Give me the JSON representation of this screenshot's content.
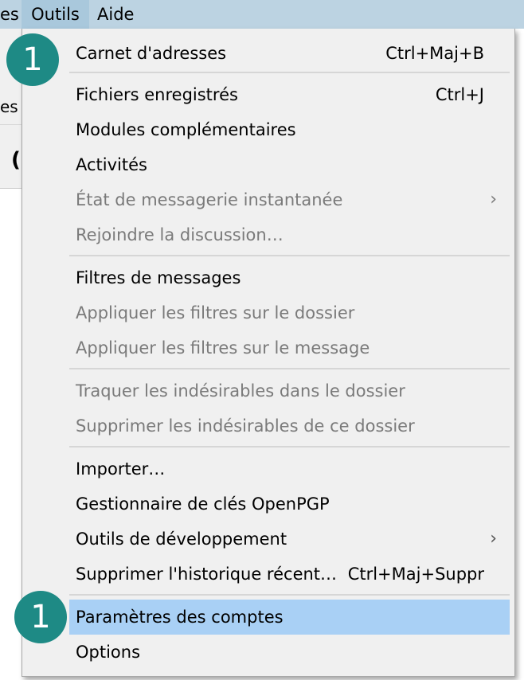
{
  "menubar": {
    "items": [
      {
        "label": "es",
        "active": false
      },
      {
        "label": "Outils",
        "active": true
      },
      {
        "label": "Aide",
        "active": false
      }
    ]
  },
  "background": {
    "tab_fragment": "es",
    "toolbar_fragment": "("
  },
  "menu": {
    "items": [
      {
        "label": "Carnet d'adresses",
        "shortcut": "Ctrl+Maj+B",
        "disabled": false,
        "submenu": false
      },
      {
        "label": "Fichiers enregistrés",
        "shortcut": "Ctrl+J",
        "disabled": false,
        "submenu": false
      },
      {
        "label": "Modules complémentaires",
        "shortcut": "",
        "disabled": false,
        "submenu": false
      },
      {
        "label": "Activités",
        "shortcut": "",
        "disabled": false,
        "submenu": false
      },
      {
        "label": "État de messagerie instantanée",
        "shortcut": "",
        "disabled": true,
        "submenu": true
      },
      {
        "label": "Rejoindre la discussion…",
        "shortcut": "",
        "disabled": true,
        "submenu": false
      },
      {
        "label": "Filtres de messages",
        "shortcut": "",
        "disabled": false,
        "submenu": false
      },
      {
        "label": "Appliquer les filtres sur le dossier",
        "shortcut": "",
        "disabled": true,
        "submenu": false
      },
      {
        "label": "Appliquer les filtres sur le message",
        "shortcut": "",
        "disabled": true,
        "submenu": false
      },
      {
        "label": "Traquer les indésirables dans le dossier",
        "shortcut": "",
        "disabled": true,
        "submenu": false
      },
      {
        "label": "Supprimer les indésirables de ce dossier",
        "shortcut": "",
        "disabled": true,
        "submenu": false
      },
      {
        "label": "Importer…",
        "shortcut": "",
        "disabled": false,
        "submenu": false
      },
      {
        "label": "Gestionnaire de clés OpenPGP",
        "shortcut": "",
        "disabled": false,
        "submenu": false
      },
      {
        "label": "Outils de développement",
        "shortcut": "",
        "disabled": false,
        "submenu": true
      },
      {
        "label": "Supprimer l'historique récent…",
        "shortcut": "Ctrl+Maj+Suppr",
        "disabled": false,
        "submenu": false
      },
      {
        "label": "Paramètres des comptes",
        "shortcut": "",
        "disabled": false,
        "submenu": false,
        "highlighted": true
      },
      {
        "label": "Options",
        "shortcut": "",
        "disabled": false,
        "submenu": false
      }
    ],
    "submenu_glyph": "›"
  },
  "badges": [
    {
      "label": "1"
    },
    {
      "label": "1"
    }
  ],
  "colors": {
    "menubar_bg": "#bcd3e2",
    "menu_bg": "#f0f0f0",
    "highlight_bg": "#a9d0f5",
    "badge_bg": "#1e8a85",
    "disabled_text": "#7a7a7a"
  }
}
